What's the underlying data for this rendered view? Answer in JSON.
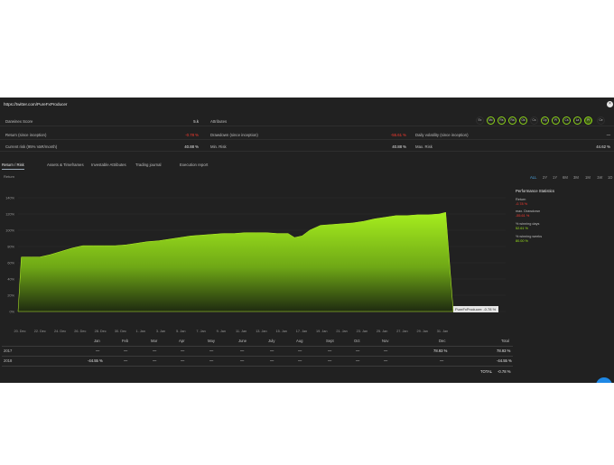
{
  "header": {
    "url": "https://twitter.com/PureFxProducer",
    "close_icon": "close-icon"
  },
  "stats": {
    "darwinex_score_label": "Darwinex Score",
    "darwinex_score_value": "5.k",
    "return_label": "Return (since inception)",
    "return_value": "-0.78 %",
    "drawdown_label": "Drawdown (since inception)",
    "drawdown_value": "-55.61 %",
    "daily_vol_label": "Daily volatility (since inception)",
    "daily_vol_value": "—",
    "current_risk_label": "Current risk (95% VaR/month)",
    "current_risk_value": "40.88 %",
    "min_risk_label": "Min. Risk",
    "min_risk_value": "40.88 %",
    "max_risk_label": "Max. Risk",
    "max_risk_value": "44.62 %",
    "attributes_label": "Attributes"
  },
  "badges": [
    {
      "label": "Ex",
      "state": "hollow"
    },
    {
      "label": "Mc",
      "state": "green"
    },
    {
      "label": "Rs",
      "state": "green"
    },
    {
      "label": "Ra",
      "state": "green"
    },
    {
      "label": "Os",
      "state": "green"
    },
    {
      "label": "Cs",
      "state": "hollow"
    },
    {
      "label": "Dp",
      "state": "green"
    },
    {
      "label": "Pl",
      "state": "green"
    },
    {
      "label": "Cs",
      "state": "green"
    },
    {
      "label": "La",
      "state": "green"
    },
    {
      "label": "Pf",
      "state": "filled"
    },
    {
      "label": "Ce",
      "state": "hollow"
    }
  ],
  "tabs": [
    "Return / Risk",
    "Assets & Timeframes",
    "Investable Attributes",
    "Trading journal",
    "Execution report"
  ],
  "section_label": "Return",
  "ranges": [
    "ALL",
    "2Y",
    "1Y",
    "6M",
    "3M",
    "1M",
    "1W",
    "1D"
  ],
  "performance": {
    "title": "Performance Statistics",
    "return_label": "Return",
    "return_value": "-0.78 %",
    "drawdown_label": "max. Drawdown",
    "drawdown_value": "-55.61 %",
    "winning_days_label": "% winning days",
    "winning_days_value": "52.61 %",
    "winning_weeks_label": "% winning weeks",
    "winning_weeks_value": "80.00 %"
  },
  "chart_data": {
    "type": "area",
    "title": "",
    "xlabel": "",
    "ylabel": "",
    "x_tick_labels": [
      "20. Dec",
      "22. Dec",
      "24. Dec",
      "26. Dec",
      "28. Dec",
      "30. Dec",
      "1. Jan",
      "3. Jan",
      "5. Jan",
      "7. Jan",
      "9. Jan",
      "11. Jan",
      "13. Jan",
      "15. Jan",
      "17. Jan",
      "19. Jan",
      "21. Jan",
      "23. Jan",
      "25. Jan",
      "27. Jan",
      "29. Jan",
      "31. Jan"
    ],
    "y_tick_labels": [
      "0%",
      "20%",
      "40%",
      "60%",
      "80%",
      "100%",
      "120%",
      "140%"
    ],
    "ylim": [
      0,
      140
    ],
    "grid": true,
    "series": [
      {
        "values": [
          [
            20,
            0
          ],
          [
            20.3,
            67
          ],
          [
            21.2,
            67
          ],
          [
            22,
            67
          ],
          [
            23,
            70
          ],
          [
            24,
            74
          ],
          [
            25,
            78
          ],
          [
            26,
            81
          ],
          [
            27,
            81
          ],
          [
            28,
            81
          ],
          [
            29,
            81
          ],
          [
            30,
            82
          ],
          [
            31,
            84
          ],
          [
            32,
            86
          ],
          [
            33,
            87
          ],
          [
            34,
            89
          ],
          [
            35,
            91
          ],
          [
            36,
            93
          ],
          [
            37,
            94
          ],
          [
            38,
            95
          ],
          [
            39,
            96
          ],
          [
            40,
            96
          ],
          [
            41,
            97
          ],
          [
            42,
            97
          ],
          [
            43,
            97
          ],
          [
            44,
            96
          ],
          [
            45,
            96
          ],
          [
            45.6,
            91
          ],
          [
            46.3,
            93
          ],
          [
            47,
            100
          ],
          [
            48,
            106
          ],
          [
            49,
            107
          ],
          [
            50,
            108
          ],
          [
            51,
            109
          ],
          [
            52,
            111
          ],
          [
            53,
            114
          ],
          [
            54,
            116
          ],
          [
            55,
            118
          ],
          [
            56,
            118
          ],
          [
            57,
            119
          ],
          [
            58,
            119
          ],
          [
            59,
            120
          ],
          [
            59.6,
            122
          ],
          [
            60.3,
            0
          ]
        ]
      }
    ],
    "tooltip": "PureFxProducer: -0.78 %"
  },
  "table": {
    "months": [
      "Jan",
      "Feb",
      "Mar",
      "Apr",
      "May",
      "June",
      "July",
      "Aug",
      "Sept",
      "Oct",
      "Nov",
      "Dec",
      "Total"
    ],
    "rows": [
      {
        "year": "2017",
        "cells": [
          "—",
          "—",
          "—",
          "—",
          "—",
          "—",
          "—",
          "—",
          "—",
          "—",
          "—",
          "78.93 %",
          "78.93 %"
        ]
      },
      {
        "year": "2018",
        "cells": [
          "-44.55 %",
          "—",
          "—",
          "—",
          "—",
          "—",
          "—",
          "—",
          "—",
          "—",
          "—",
          "—",
          "-44.55 %"
        ]
      }
    ],
    "total_label": "TOTAL",
    "total_value": "-0.78 %"
  },
  "colors": {
    "background": "#212121",
    "area_fill_top": "#9be21c",
    "area_fill_bottom": "#1e2a10",
    "negative": "#ff3b30",
    "positive": "#9be21c",
    "accent": "#1e88e5"
  }
}
